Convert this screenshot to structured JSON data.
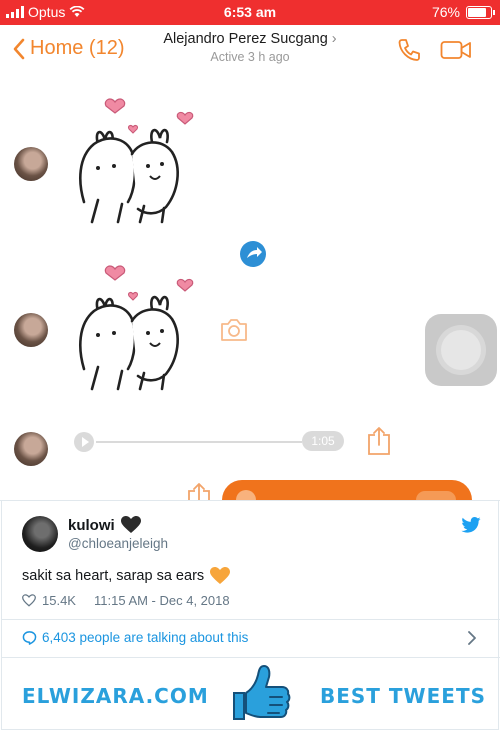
{
  "status_bar": {
    "carrier": "Optus",
    "time": "6:53 am",
    "battery": "76%",
    "battery_level": 0.76
  },
  "header": {
    "back_label": "Home (12)",
    "contact_name": "Alejandro Perez Sucgang",
    "contact_status": "Active 3 h ago",
    "icons": [
      "chevron-left-icon",
      "phone-icon",
      "video-camera-icon"
    ]
  },
  "chat": {
    "audio_duration": "1:05",
    "icons": [
      "forward-icon",
      "camera-icon",
      "share-icon",
      "assistive-touch-button"
    ]
  },
  "tweet": {
    "name": "kulowi",
    "name_emoji": "black-heart",
    "handle": "@chloeanjeleigh",
    "text": "sakit sa heart, sarap sa ears",
    "text_emoji": "orange-heart",
    "likes": "15.4K",
    "timestamp": "11:15 AM - Dec 4, 2018",
    "talking": "6,403 people are talking about this"
  },
  "footer": {
    "left": "ELWIZARA.COM",
    "right": "BEST TWEETS"
  },
  "colors": {
    "status_bar": "#ef2f2f",
    "messenger_orange": "#f2862e",
    "twitter_blue": "#1da1f2",
    "brand_blue": "#2aa0dc"
  }
}
